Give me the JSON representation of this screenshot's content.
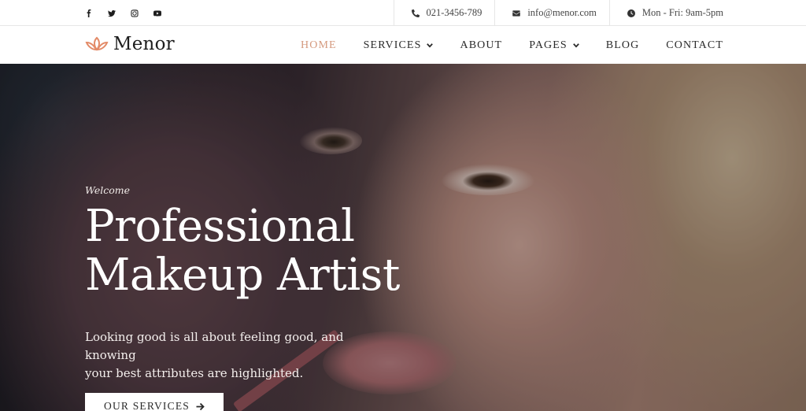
{
  "topbar": {
    "social": [
      {
        "name": "facebook",
        "icon": "facebook-icon"
      },
      {
        "name": "twitter",
        "icon": "twitter-icon"
      },
      {
        "name": "instagram",
        "icon": "instagram-icon"
      },
      {
        "name": "youtube",
        "icon": "youtube-icon"
      }
    ],
    "phone": "021-3456-789",
    "email": "info@menor.com",
    "hours": "Mon - Fri: 9am-5pm"
  },
  "header": {
    "logo_text": "Menor",
    "nav": [
      {
        "label": "HOME",
        "active": true,
        "dropdown": false
      },
      {
        "label": "SERVICES",
        "active": false,
        "dropdown": true
      },
      {
        "label": "ABOUT",
        "active": false,
        "dropdown": false
      },
      {
        "label": "PAGES",
        "active": false,
        "dropdown": true
      },
      {
        "label": "BLOG",
        "active": false,
        "dropdown": false
      },
      {
        "label": "CONTACT",
        "active": false,
        "dropdown": false
      }
    ]
  },
  "hero": {
    "eyebrow": "Welcome",
    "title_line1": "Professional",
    "title_line2": "Makeup Artist",
    "desc_line1": "Looking good is all about feeling good, and knowing",
    "desc_line2": "your best attributes are highlighted.",
    "cta_label": "OUR SERVICES",
    "cta_icon": "arrow-right-icon"
  },
  "colors": {
    "accent": "#d59a7f",
    "text_dark": "#2a2a2a"
  }
}
